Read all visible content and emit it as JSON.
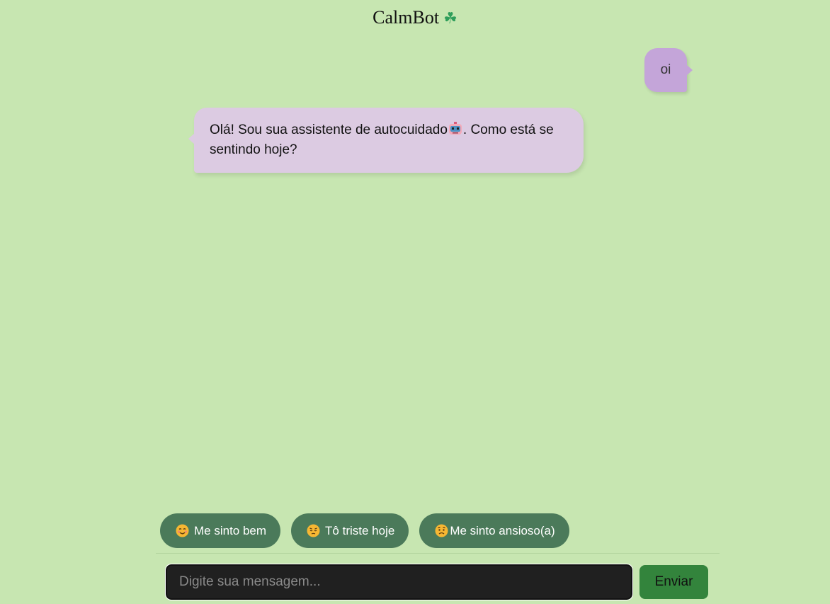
{
  "header": {
    "title": "CalmBot",
    "title_icon": "four-leaf-clover-icon"
  },
  "chat": {
    "messages": [
      {
        "sender": "user",
        "text": "oi"
      },
      {
        "sender": "bot",
        "text_before_emoji": "Olá! Sou sua assistente de autocuidado",
        "emoji": "robot-face-emoji",
        "text_after_emoji": ". Como está se sentindo hoje?"
      }
    ]
  },
  "quick_replies": [
    {
      "icon": "smiling-face-emoji",
      "label": "Me sinto bem"
    },
    {
      "icon": "pensive-face-emoji",
      "label": "Tô triste hoje"
    },
    {
      "icon": "worried-face-emoji",
      "label": "Me sinto ansioso(a)"
    }
  ],
  "composer": {
    "placeholder": "Digite sua mensagem...",
    "value": "",
    "send_label": "Enviar"
  },
  "colors": {
    "background": "#c7e6b1",
    "user_bubble": "#c4a5d9",
    "bot_bubble": "#dccbe2",
    "quick_reply": "#4b7a5a",
    "send_button": "#33843c",
    "input_background": "#202020"
  }
}
